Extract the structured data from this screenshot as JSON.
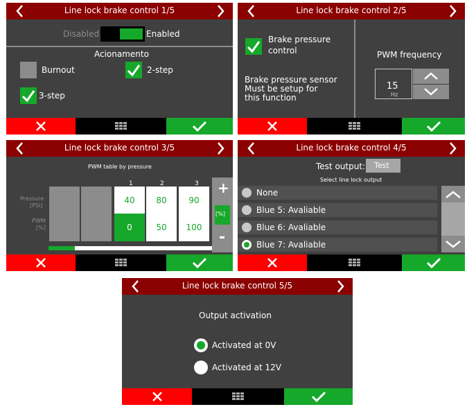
{
  "screens": {
    "s1": {
      "title": "Line lock brake control 1/5",
      "toggle_disabled": "Disabled",
      "toggle_enabled": "Enabled",
      "section_title": "Acionamento",
      "options": [
        "Burnout",
        "2-step",
        "3-step"
      ],
      "checked": [
        false,
        true,
        true
      ]
    },
    "s2": {
      "title": "Line lock brake control 2/5",
      "checkbox_label_1": "Brake pressure",
      "checkbox_label_2": "control",
      "note_1": "Brake pressure sensor",
      "note_2": "Must be setup for",
      "note_3": "this function",
      "pwm_title": "PWM frequency",
      "pwm_value": "15",
      "pwm_unit": "Hz"
    },
    "s3": {
      "title": "Line lock brake control 3/5",
      "subtitle": "PWM table by pressure",
      "columns": [
        "1",
        "2",
        "3"
      ],
      "row_pressure_1": "Pressure",
      "row_pressure_2": "[PSI]",
      "row_pwm_1": "PWM",
      "row_pwm_2": "[%]",
      "pressure_values": [
        "40",
        "80",
        "90"
      ],
      "pwm_values": [
        "0",
        "50",
        "100"
      ],
      "plus": "+",
      "unit": "[%]",
      "minus": "-",
      "scroll_progress": 0.16
    },
    "s4": {
      "title": "Line lock brake control 4/5",
      "test_label": "Test output:",
      "test_button": "Test",
      "select_label": "Select line lock output",
      "items": [
        "None",
        "Blue 5: Avaliable",
        "Blue 6: Avaliable",
        "Blue 7: Avaliable"
      ],
      "selected_index": 3
    },
    "s5": {
      "title": "Line lock brake control 5/5",
      "heading": "Output activation",
      "option_0v": "Activated at 0V",
      "option_12v": "Activated at 12V",
      "selected": "Activated at 0V"
    }
  },
  "colors": {
    "header": "#8b0000",
    "panel": "#404040",
    "accent": "#16a82a",
    "cancel": "#ff0000"
  }
}
